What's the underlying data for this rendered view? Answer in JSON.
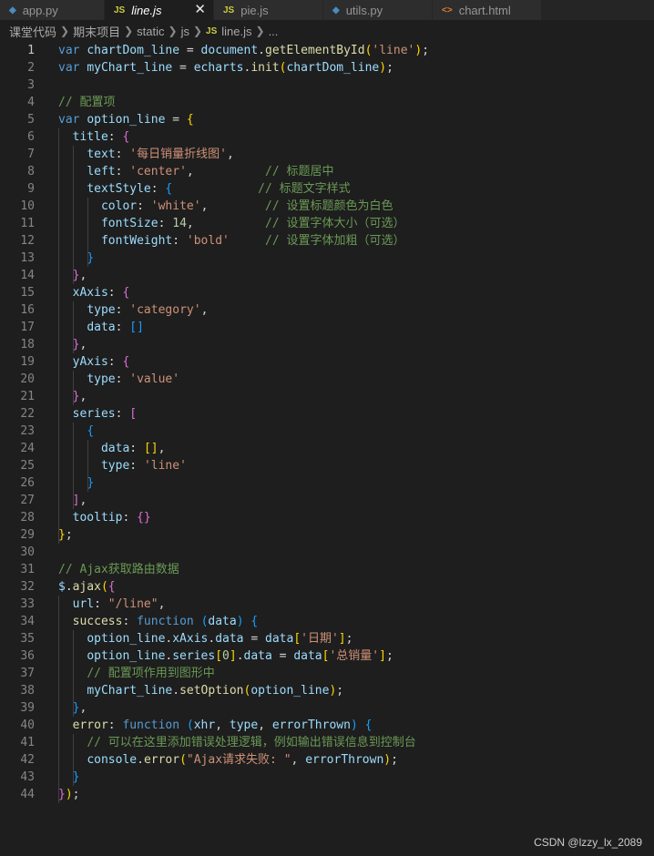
{
  "tabs": [
    {
      "icon": "python-icon",
      "glyph": "◆",
      "color": "#4b8bbe",
      "label": "app.py",
      "active": false,
      "italic": false,
      "width": 115
    },
    {
      "icon": "javascript-icon",
      "glyph": "JS",
      "color": "#cbcb41",
      "label": "line.js",
      "active": true,
      "italic": true,
      "width": 120,
      "close": "✕"
    },
    {
      "icon": "javascript-icon",
      "glyph": "JS",
      "color": "#cbcb41",
      "label": "pie.js",
      "active": false,
      "italic": false,
      "width": 120
    },
    {
      "icon": "python-icon",
      "glyph": "◆",
      "color": "#4b8bbe",
      "label": "utils.py",
      "active": false,
      "italic": false,
      "width": 120
    },
    {
      "icon": "html-icon",
      "glyph": "<>",
      "color": "#e37933",
      "label": "chart.html",
      "active": false,
      "italic": false,
      "width": 120
    }
  ],
  "breadcrumb": [
    "课堂代码",
    "期末项目",
    "static",
    "js",
    "line.js",
    "..."
  ],
  "current_line": 1,
  "lines": [
    [
      [
        "k",
        "var "
      ],
      [
        "v",
        "chartDom_line"
      ],
      [
        "p",
        " = "
      ],
      [
        "v",
        "document"
      ],
      [
        "p",
        "."
      ],
      [
        "f",
        "getElementById"
      ],
      [
        "b1",
        "("
      ],
      [
        "s",
        "'line'"
      ],
      [
        "b1",
        ")"
      ],
      [
        "p",
        ";"
      ]
    ],
    [
      [
        "k",
        "var "
      ],
      [
        "v",
        "myChart_line"
      ],
      [
        "p",
        " = "
      ],
      [
        "v",
        "echarts"
      ],
      [
        "p",
        "."
      ],
      [
        "f",
        "init"
      ],
      [
        "b1",
        "("
      ],
      [
        "v",
        "chartDom_line"
      ],
      [
        "b1",
        ")"
      ],
      [
        "p",
        ";"
      ]
    ],
    [],
    [
      [
        "c",
        "// 配置项"
      ]
    ],
    [
      [
        "k",
        "var "
      ],
      [
        "v",
        "option_line"
      ],
      [
        "p",
        " = "
      ],
      [
        "b1",
        "{"
      ]
    ],
    [
      [
        "p",
        "  "
      ],
      [
        "v",
        "title"
      ],
      [
        "p",
        ": "
      ],
      [
        "b2",
        "{"
      ]
    ],
    [
      [
        "p",
        "    "
      ],
      [
        "v",
        "text"
      ],
      [
        "p",
        ": "
      ],
      [
        "s",
        "'每日销量折线图'"
      ],
      [
        "p",
        ","
      ]
    ],
    [
      [
        "p",
        "    "
      ],
      [
        "v",
        "left"
      ],
      [
        "p",
        ": "
      ],
      [
        "s",
        "'center'"
      ],
      [
        "p",
        ",          "
      ],
      [
        "c",
        "// 标题居中"
      ]
    ],
    [
      [
        "p",
        "    "
      ],
      [
        "v",
        "textStyle"
      ],
      [
        "p",
        ": "
      ],
      [
        "b3",
        "{"
      ],
      [
        "p",
        "            "
      ],
      [
        "c",
        "// 标题文字样式"
      ]
    ],
    [
      [
        "p",
        "      "
      ],
      [
        "v",
        "color"
      ],
      [
        "p",
        ": "
      ],
      [
        "s",
        "'white'"
      ],
      [
        "p",
        ",        "
      ],
      [
        "c",
        "// 设置标题颜色为白色"
      ]
    ],
    [
      [
        "p",
        "      "
      ],
      [
        "v",
        "fontSize"
      ],
      [
        "p",
        ": "
      ],
      [
        "n",
        "14"
      ],
      [
        "p",
        ",          "
      ],
      [
        "c",
        "// 设置字体大小（可选）"
      ]
    ],
    [
      [
        "p",
        "      "
      ],
      [
        "v",
        "fontWeight"
      ],
      [
        "p",
        ": "
      ],
      [
        "s",
        "'bold'"
      ],
      [
        "p",
        "     "
      ],
      [
        "c",
        "// 设置字体加粗（可选）"
      ]
    ],
    [
      [
        "p",
        "    "
      ],
      [
        "b3",
        "}"
      ]
    ],
    [
      [
        "p",
        "  "
      ],
      [
        "b2",
        "}"
      ],
      [
        "p",
        ","
      ]
    ],
    [
      [
        "p",
        "  "
      ],
      [
        "v",
        "xAxis"
      ],
      [
        "p",
        ": "
      ],
      [
        "b2",
        "{"
      ]
    ],
    [
      [
        "p",
        "    "
      ],
      [
        "v",
        "type"
      ],
      [
        "p",
        ": "
      ],
      [
        "s",
        "'category'"
      ],
      [
        "p",
        ","
      ]
    ],
    [
      [
        "p",
        "    "
      ],
      [
        "v",
        "data"
      ],
      [
        "p",
        ": "
      ],
      [
        "b3",
        "[]"
      ]
    ],
    [
      [
        "p",
        "  "
      ],
      [
        "b2",
        "}"
      ],
      [
        "p",
        ","
      ]
    ],
    [
      [
        "p",
        "  "
      ],
      [
        "v",
        "yAxis"
      ],
      [
        "p",
        ": "
      ],
      [
        "b2",
        "{"
      ]
    ],
    [
      [
        "p",
        "    "
      ],
      [
        "v",
        "type"
      ],
      [
        "p",
        ": "
      ],
      [
        "s",
        "'value'"
      ]
    ],
    [
      [
        "p",
        "  "
      ],
      [
        "b2",
        "}"
      ],
      [
        "p",
        ","
      ]
    ],
    [
      [
        "p",
        "  "
      ],
      [
        "v",
        "series"
      ],
      [
        "p",
        ": "
      ],
      [
        "b2",
        "["
      ]
    ],
    [
      [
        "p",
        "    "
      ],
      [
        "b3",
        "{"
      ]
    ],
    [
      [
        "p",
        "      "
      ],
      [
        "v",
        "data"
      ],
      [
        "p",
        ": "
      ],
      [
        "b1",
        "[]"
      ],
      [
        "p",
        ","
      ]
    ],
    [
      [
        "p",
        "      "
      ],
      [
        "v",
        "type"
      ],
      [
        "p",
        ": "
      ],
      [
        "s",
        "'line'"
      ]
    ],
    [
      [
        "p",
        "    "
      ],
      [
        "b3",
        "}"
      ]
    ],
    [
      [
        "p",
        "  "
      ],
      [
        "b2",
        "]"
      ],
      [
        "p",
        ","
      ]
    ],
    [
      [
        "p",
        "  "
      ],
      [
        "v",
        "tooltip"
      ],
      [
        "p",
        ": "
      ],
      [
        "b2",
        "{}"
      ]
    ],
    [
      [
        "b1",
        "}"
      ],
      [
        "p",
        ";"
      ]
    ],
    [],
    [
      [
        "c",
        "// Ajax获取路由数据"
      ]
    ],
    [
      [
        "v",
        "$"
      ],
      [
        "p",
        "."
      ],
      [
        "f",
        "ajax"
      ],
      [
        "b1",
        "("
      ],
      [
        "b2",
        "{"
      ]
    ],
    [
      [
        "p",
        "  "
      ],
      [
        "v",
        "url"
      ],
      [
        "p",
        ": "
      ],
      [
        "s",
        "\"/line\""
      ],
      [
        "p",
        ","
      ]
    ],
    [
      [
        "p",
        "  "
      ],
      [
        "f",
        "success"
      ],
      [
        "p",
        ": "
      ],
      [
        "k",
        "function "
      ],
      [
        "b3",
        "("
      ],
      [
        "v",
        "data"
      ],
      [
        "b3",
        ")"
      ],
      [
        "p",
        " "
      ],
      [
        "b3",
        "{"
      ]
    ],
    [
      [
        "p",
        "    "
      ],
      [
        "v",
        "option_line"
      ],
      [
        "p",
        "."
      ],
      [
        "v",
        "xAxis"
      ],
      [
        "p",
        "."
      ],
      [
        "v",
        "data"
      ],
      [
        "p",
        " = "
      ],
      [
        "v",
        "data"
      ],
      [
        "b1",
        "["
      ],
      [
        "s",
        "'日期'"
      ],
      [
        "b1",
        "]"
      ],
      [
        "p",
        ";"
      ]
    ],
    [
      [
        "p",
        "    "
      ],
      [
        "v",
        "option_line"
      ],
      [
        "p",
        "."
      ],
      [
        "v",
        "series"
      ],
      [
        "b1",
        "["
      ],
      [
        "n",
        "0"
      ],
      [
        "b1",
        "]"
      ],
      [
        "p",
        "."
      ],
      [
        "v",
        "data"
      ],
      [
        "p",
        " = "
      ],
      [
        "v",
        "data"
      ],
      [
        "b1",
        "["
      ],
      [
        "s",
        "'总销量'"
      ],
      [
        "b1",
        "]"
      ],
      [
        "p",
        ";"
      ]
    ],
    [
      [
        "p",
        "    "
      ],
      [
        "c",
        "// 配置项作用到图形中"
      ]
    ],
    [
      [
        "p",
        "    "
      ],
      [
        "v",
        "myChart_line"
      ],
      [
        "p",
        "."
      ],
      [
        "f",
        "setOption"
      ],
      [
        "b1",
        "("
      ],
      [
        "v",
        "option_line"
      ],
      [
        "b1",
        ")"
      ],
      [
        "p",
        ";"
      ]
    ],
    [
      [
        "p",
        "  "
      ],
      [
        "b3",
        "}"
      ],
      [
        "p",
        ","
      ]
    ],
    [
      [
        "p",
        "  "
      ],
      [
        "f",
        "error"
      ],
      [
        "p",
        ": "
      ],
      [
        "k",
        "function "
      ],
      [
        "b3",
        "("
      ],
      [
        "v",
        "xhr"
      ],
      [
        "p",
        ", "
      ],
      [
        "v",
        "type"
      ],
      [
        "p",
        ", "
      ],
      [
        "v",
        "errorThrown"
      ],
      [
        "b3",
        ")"
      ],
      [
        "p",
        " "
      ],
      [
        "b3",
        "{"
      ]
    ],
    [
      [
        "p",
        "    "
      ],
      [
        "c",
        "// 可以在这里添加错误处理逻辑，例如输出错误信息到控制台"
      ]
    ],
    [
      [
        "p",
        "    "
      ],
      [
        "v",
        "console"
      ],
      [
        "p",
        "."
      ],
      [
        "f",
        "error"
      ],
      [
        "b1",
        "("
      ],
      [
        "s",
        "\"Ajax请求失败: \""
      ],
      [
        "p",
        ", "
      ],
      [
        "v",
        "errorThrown"
      ],
      [
        "b1",
        ")"
      ],
      [
        "p",
        ";"
      ]
    ],
    [
      [
        "p",
        "  "
      ],
      [
        "b3",
        "}"
      ]
    ],
    [
      [
        "b2",
        "}"
      ],
      [
        "b1",
        ")"
      ],
      [
        "p",
        ";"
      ]
    ]
  ],
  "watermark": "CSDN @lzzy_lx_2089"
}
